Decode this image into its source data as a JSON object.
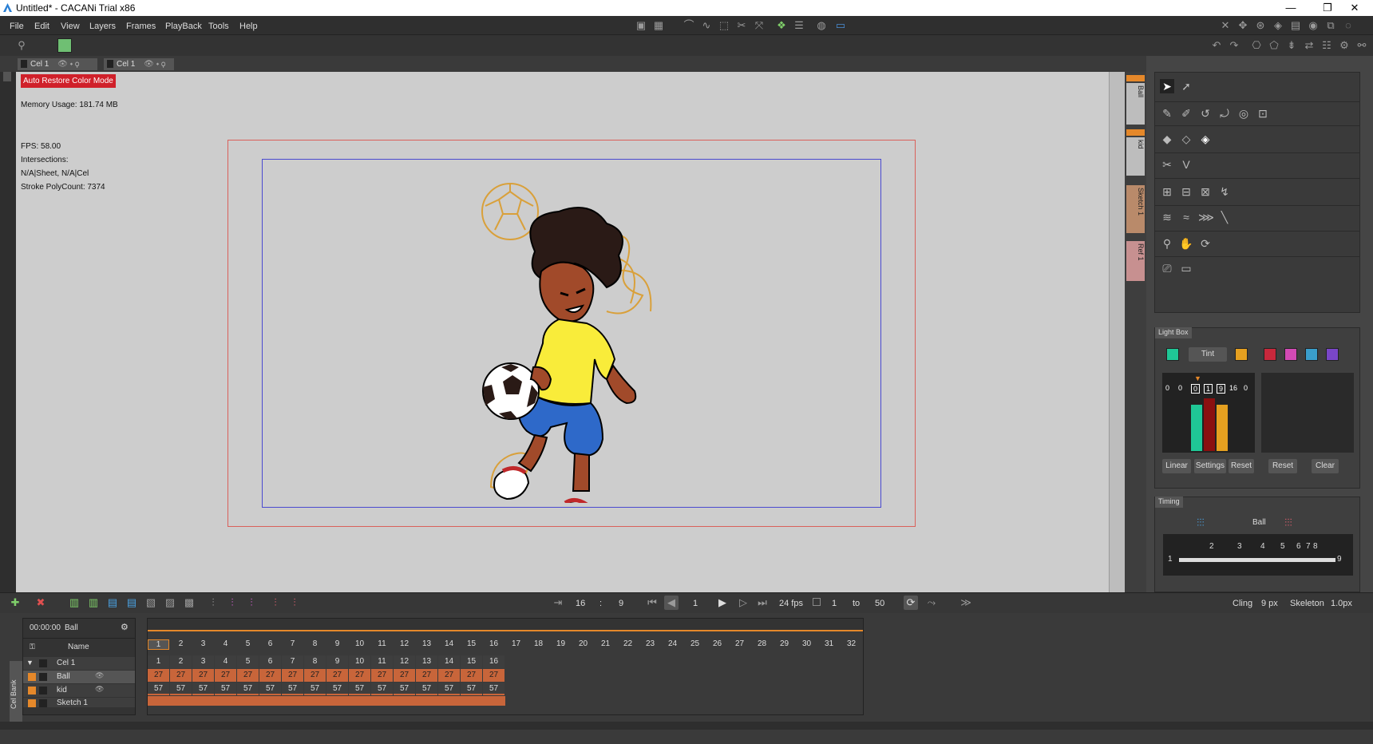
{
  "window": {
    "title": "Untitled* - CACANi Trial  x86",
    "minimize": "—",
    "restore": "❐",
    "close": "✕"
  },
  "menu": [
    "File",
    "Edit",
    "View",
    "Layers",
    "Frames",
    "PlayBack",
    "Tools",
    "Help"
  ],
  "tabs": [
    {
      "label": "Cel 1"
    },
    {
      "label": "Cel 1"
    }
  ],
  "canvas": {
    "auto_restore": "Auto Restore Color Mode",
    "memory": "Memory Usage: 181.74 MB",
    "fps": "FPS: 58.00",
    "intersections": "Intersections:",
    "na": "N/A|Sheet, N/A|Cel",
    "stroke": "Stroke PolyCount: 7374"
  },
  "side_layers": [
    "Ball",
    "kid",
    "Sketch 1",
    "Ref 1"
  ],
  "lightbox": {
    "title": "Light Box",
    "tint": "Tint",
    "counters": [
      "0",
      "0",
      "0",
      "1",
      "9",
      "16",
      "0"
    ],
    "buttons": [
      "Linear",
      "Settings",
      "Reset",
      "Reset",
      "Clear"
    ],
    "colors": [
      "#1fc796",
      "#e5a020",
      "#c8283c",
      "#d24ab4",
      "#3a9ecb",
      "#7a46c8"
    ]
  },
  "timing": {
    "title": "Timing",
    "layer": "Ball",
    "marks": [
      "1",
      "2",
      "3",
      "4",
      "5",
      "6",
      "7",
      "8",
      "9"
    ],
    "cling_label": "Cling",
    "cling_value": "9 px",
    "skeleton_label": "Skeleton",
    "skeleton_value": "1.0px"
  },
  "playback": {
    "frames_total": "16",
    "sep": ":",
    "frame_sub": "9",
    "current": "1",
    "fps": "24 fps",
    "range_from": "1",
    "to": "to",
    "range_to": "50"
  },
  "timeline": {
    "time": "00:00:00",
    "layer": "Ball",
    "name_header": "Name",
    "frame_numbers": [
      "1",
      "2",
      "3",
      "4",
      "5",
      "6",
      "7",
      "8",
      "9",
      "10",
      "11",
      "12",
      "13",
      "14",
      "15",
      "16",
      "17",
      "18",
      "19",
      "20",
      "21",
      "22",
      "23",
      "24",
      "25",
      "26",
      "27",
      "28",
      "29",
      "30",
      "31",
      "32"
    ],
    "cel_bank": "Cel Bank",
    "rows": [
      {
        "name": "Cel 1",
        "cells": [
          "1",
          "2",
          "3",
          "4",
          "5",
          "6",
          "7",
          "8",
          "9",
          "10",
          "11",
          "12",
          "13",
          "14",
          "15",
          "16"
        ]
      },
      {
        "name": "Ball",
        "cells": [
          "27",
          "27",
          "27",
          "27",
          "27",
          "27",
          "27",
          "27",
          "27",
          "27",
          "27",
          "27",
          "27",
          "27",
          "27",
          "27"
        ]
      },
      {
        "name": "kid",
        "cells": [
          "57",
          "57",
          "57",
          "57",
          "57",
          "57",
          "57",
          "57",
          "57",
          "57",
          "57",
          "57",
          "57",
          "57",
          "57",
          "57"
        ]
      },
      {
        "name": "Sketch 1",
        "cells": []
      }
    ]
  }
}
